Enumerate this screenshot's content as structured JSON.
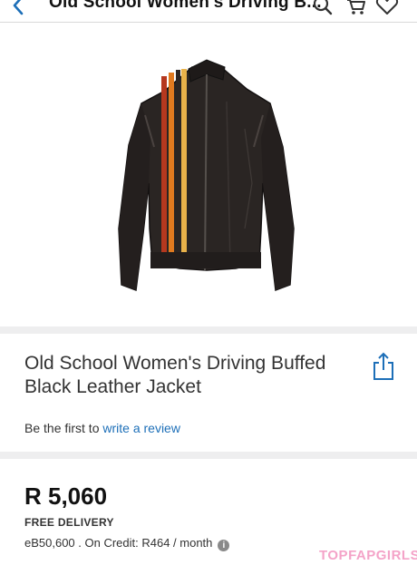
{
  "header": {
    "title": "Old School Women's Driving B...",
    "back_icon": "chevron-left-icon",
    "search_icon": "search-icon",
    "cart_icon": "cart-icon",
    "wishlist_icon": "heart-icon",
    "accent": "#1d6fb8"
  },
  "gallery": {
    "image": "black leather jacket with orange, yellow and red racing stripes",
    "image_count": 3,
    "active_index": 0,
    "active_dot_color": "#4caf50"
  },
  "product": {
    "title": "Old School Women's Driving Buffed Black Leather Jacket",
    "share_icon": "share-icon",
    "review_prefix": "Be the first to",
    "review_link": "write a review"
  },
  "pricing": {
    "price": "R 5,060",
    "delivery": "FREE DELIVERY",
    "credit": "eB50,600 . On Credit: R464 / month",
    "info_icon": "info-icon"
  },
  "watermark": "TOPFAPGIRLS"
}
